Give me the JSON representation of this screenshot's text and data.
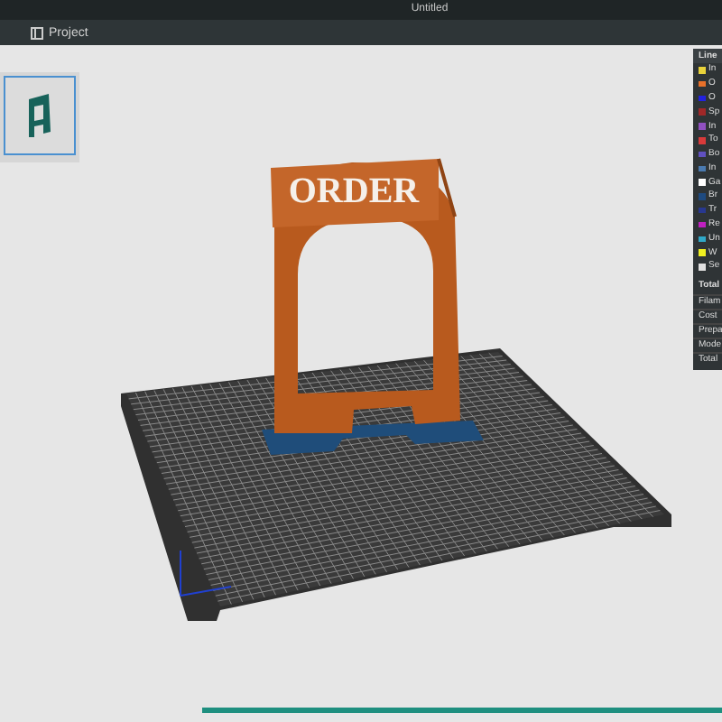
{
  "window": {
    "title": "Untitled"
  },
  "toolbar": {
    "tabs": [
      {
        "label": "Project"
      }
    ]
  },
  "plates": [
    {
      "selected": true
    }
  ],
  "model": {
    "label": "ORDER"
  },
  "legend": {
    "header": "Line",
    "items": [
      {
        "label": "In",
        "color": "#e8d23a"
      },
      {
        "label": "O",
        "color": "#e8712a"
      },
      {
        "label": "O",
        "color": "#2222e0"
      },
      {
        "label": "Sp",
        "color": "#a02828"
      },
      {
        "label": "In",
        "color": "#9050c0"
      },
      {
        "label": "To",
        "color": "#d83a3a"
      },
      {
        "label": "Bo",
        "color": "#6050c0"
      },
      {
        "label": "In",
        "color": "#4a7ab0"
      },
      {
        "label": "Ga",
        "color": "#ffffff"
      },
      {
        "label": "Br",
        "color": "#1e4a80"
      },
      {
        "label": "Tr",
        "color": "#283890"
      },
      {
        "label": "Re",
        "color": "#c020c0"
      },
      {
        "label": "Un",
        "color": "#30a8c8"
      },
      {
        "label": "W",
        "color": "#f0f020"
      },
      {
        "label": "Se",
        "color": "#e0e0e0"
      }
    ],
    "summary_title": "Total",
    "summary": [
      "Filam",
      "Cost",
      "Prepa",
      "Mode",
      "Total"
    ]
  },
  "progress": {
    "level": 1
  }
}
